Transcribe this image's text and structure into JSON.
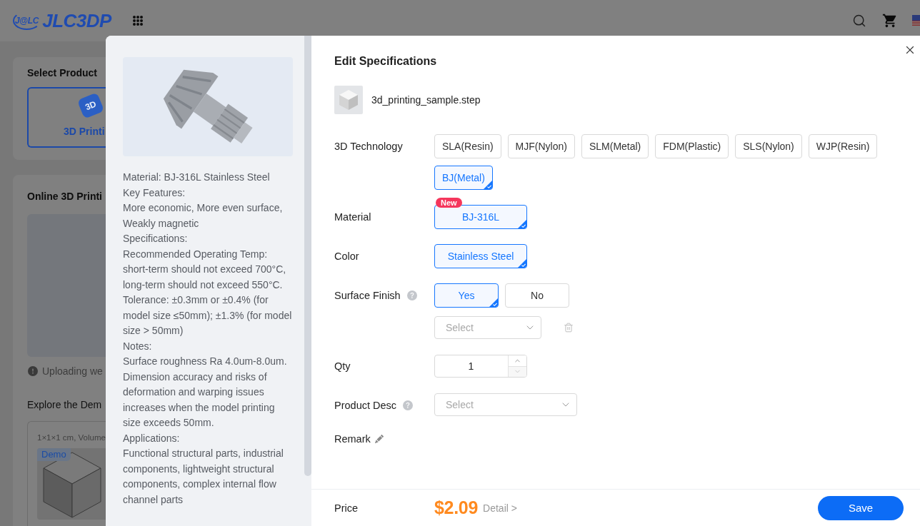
{
  "header": {
    "logo": {
      "mark": "J@LC",
      "text": "JLC3DP"
    }
  },
  "select_product": {
    "title": "Select Product",
    "products": [
      {
        "icon_text": "3D",
        "label": "3D Printi",
        "selected": true
      }
    ]
  },
  "online_printing": {
    "title": "Online 3D Printi",
    "notice": "Uploading we",
    "demo_heading": "Explore the Dem",
    "demo_card": {
      "caption": "1×1×1 cm, Volume",
      "badge": "Demo"
    }
  },
  "dialog": {
    "info_panel": {
      "description": [
        "Material: BJ-316L Stainless Steel",
        "Key Features:",
        "More economic, More even surface, Weakly magnetic",
        "Specifications:",
        "Recommended Operating Temp: short-term should not exceed 700°C, long-term should not exceed 550°C.",
        "Tolerance: ±0.3mm or ±0.4% (for model size ≤50mm); ±1.3% (for model size > 50mm)",
        "Notes:",
        "Surface roughness Ra 4.0um-8.0um. Dimension accuracy and risks of deformation and warping issues increases when the model printing size exceeds 50mm.",
        "Applications:",
        "Functional structural parts, industrial components, lightweight structural components, complex internal flow channel parts"
      ]
    },
    "title": "Edit Specifications",
    "file": {
      "name": "3d_printing_sample.step"
    },
    "fields": [
      {
        "kind": "options",
        "label": "3D Technology",
        "options": [
          {
            "label": "SLA(Resin)",
            "selected": false
          },
          {
            "label": "MJF(Nylon)",
            "selected": false
          },
          {
            "label": "SLM(Metal)",
            "selected": false
          },
          {
            "label": "FDM(Plastic)",
            "selected": false
          },
          {
            "label": "SLS(Nylon)",
            "selected": false
          },
          {
            "label": "WJP(Resin)",
            "selected": false
          },
          {
            "label": "BJ(Metal)",
            "selected": true
          }
        ]
      },
      {
        "kind": "options",
        "label": "Material",
        "options": [
          {
            "label": "BJ-316L",
            "selected": true,
            "badge": "New"
          }
        ]
      },
      {
        "kind": "options",
        "label": "Color",
        "options": [
          {
            "label": "Stainless Steel",
            "selected": true
          }
        ]
      },
      {
        "kind": "options",
        "label": "Surface Finish",
        "help": true,
        "options": [
          {
            "label": "Yes",
            "selected": true
          },
          {
            "label": "No",
            "selected": false
          }
        ],
        "select": {
          "placeholder": "Select"
        }
      },
      {
        "kind": "number",
        "label": "Qty",
        "value": "1"
      },
      {
        "kind": "select",
        "label": "Product Desc",
        "help": true,
        "placeholder": "Select"
      },
      {
        "kind": "remark",
        "label": "Remark"
      }
    ],
    "footer": {
      "price_label": "Price",
      "price": "$2.09",
      "detail_link": "Detail >",
      "save_button": "Save"
    }
  }
}
